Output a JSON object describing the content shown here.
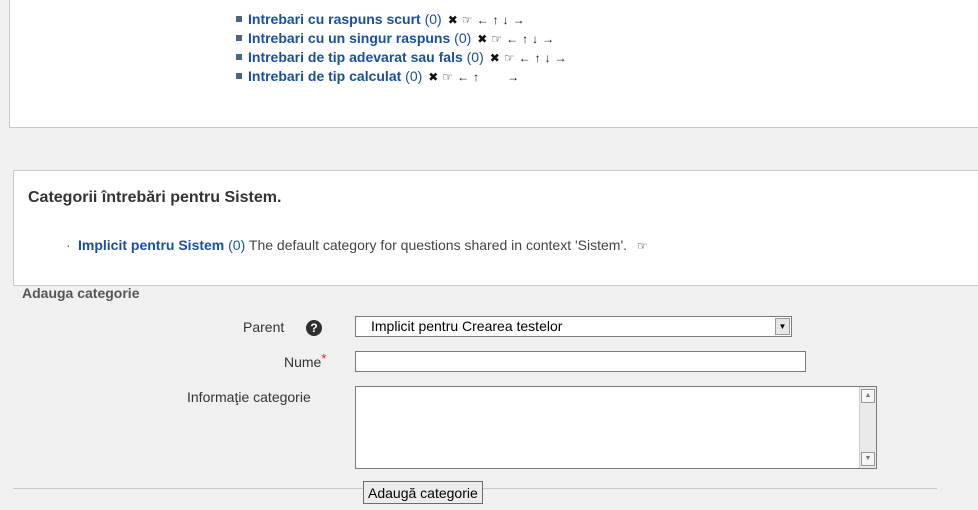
{
  "categories": [
    {
      "label": "Intrebari cu raspuns scurt",
      "count": "(0)",
      "has_down": true
    },
    {
      "label": "Intrebari cu un singur raspuns",
      "count": "(0)",
      "has_down": true
    },
    {
      "label": "Intrebari de tip adevarat sau fals",
      "count": "(0)",
      "has_down": true
    },
    {
      "label": "Intrebari de tip calculat",
      "count": "(0)",
      "has_down": false
    }
  ],
  "icons": {
    "delete": "✖",
    "edit": "☞",
    "left": "←",
    "up": "↑",
    "down": "↓",
    "right": "→"
  },
  "system": {
    "heading": "Categorii întrebări pentru Sistem.",
    "item_label": "Implicit pentru Sistem",
    "item_count": "(0)",
    "item_desc": "The default category for questions shared in context 'Sistem'."
  },
  "form": {
    "legend": "Adauga categorie",
    "parent_label": "Parent",
    "parent_value": "Implicit pentru Crearea testelor",
    "name_label": "Nume",
    "required_mark": "*",
    "info_label": "Informaţie categorie",
    "name_value": "",
    "info_value": "",
    "submit_label": "Adaugă categorie"
  }
}
